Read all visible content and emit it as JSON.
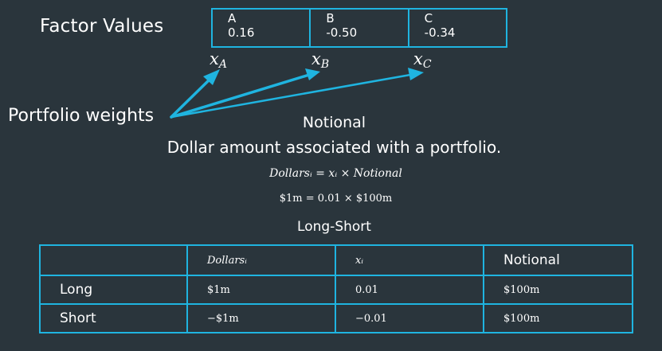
{
  "factor_values": {
    "title": "Factor Values",
    "columns": [
      {
        "name": "A",
        "value": "0.16"
      },
      {
        "name": "B",
        "value": "-0.50"
      },
      {
        "name": "C",
        "value": "-0.34"
      }
    ]
  },
  "variables": [
    {
      "symbol": "x",
      "subscript": "A"
    },
    {
      "symbol": "x",
      "subscript": "B"
    },
    {
      "symbol": "x",
      "subscript": "C"
    }
  ],
  "portfolio_weights_label": "Portfolio weights",
  "arrow_color": "#1fb4e0",
  "notional": {
    "title": "Notional",
    "description": "Dollar amount associated with a portfolio.",
    "formula_1": "Dollarsᵢ = xᵢ × Notional",
    "formula_2": "$1m = 0.01 × $100m"
  },
  "long_short": {
    "title": "Long-Short",
    "headers": [
      "",
      "Dollarsᵢ",
      "xᵢ",
      "Notional"
    ],
    "rows": [
      {
        "label": "Long",
        "dollars": "$1m",
        "x": "0.01",
        "notional": "$100m"
      },
      {
        "label": "Short",
        "dollars": "−$1m",
        "x": "−0.01",
        "notional": "$100m"
      }
    ]
  }
}
